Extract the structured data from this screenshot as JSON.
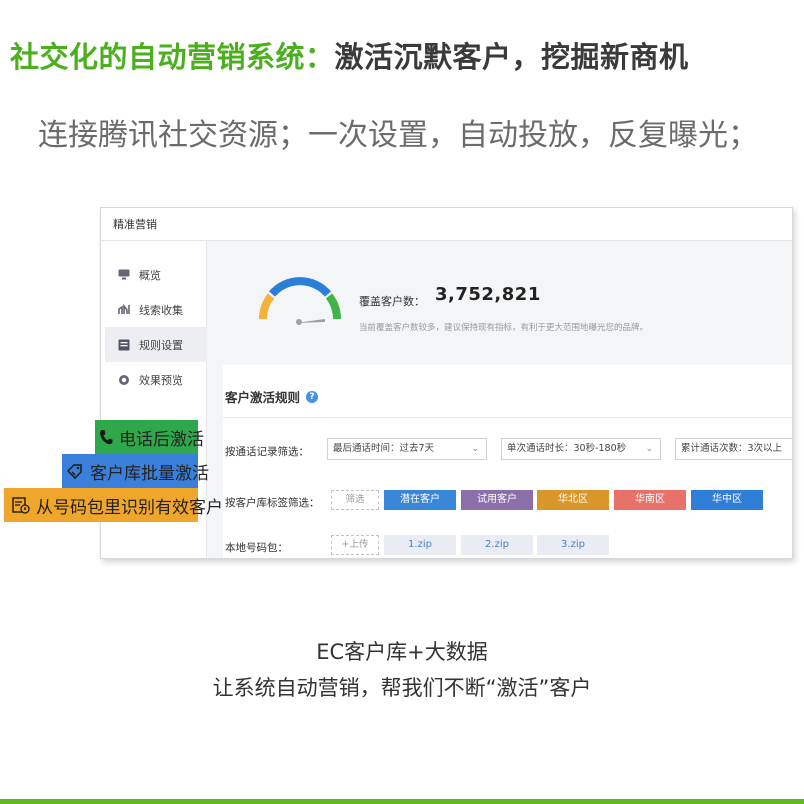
{
  "headline": {
    "green_part": "社交化的自动营销系统",
    "sep": "：",
    "dark_part": "激活沉默客户，挖掘新商机"
  },
  "subline": "连接腾讯社交资源；一次设置，自动投放，反复曝光；",
  "app": {
    "title": "精准营销",
    "sidebar": [
      {
        "label": "概览",
        "icon": "monitor-icon"
      },
      {
        "label": "线索收集",
        "icon": "funnel-icon"
      },
      {
        "label": "规则设置",
        "icon": "rules-icon"
      },
      {
        "label": "效果预览",
        "icon": "eye-icon"
      }
    ],
    "cover": {
      "label": "覆盖客户数：",
      "value": "3,752,821",
      "note": "当前覆盖客户数较多，建议保持现有指标，有利于更大范围地曝光您的品牌。"
    },
    "rules": {
      "title": "客户激活规则",
      "call_filter_label": "按通话记录筛选：",
      "call_filters": [
        "最后通话时间：过去7天",
        "单次通话时长：30秒-180秒",
        "累计通话次数：3次以上"
      ],
      "tag_filter_label": "按客户库标签筛选：",
      "tag_filter_button": "筛选",
      "tags": [
        {
          "label": "潜在客户",
          "color": "#3a86d6"
        },
        {
          "label": "试用客户",
          "color": "#8c6fa8"
        },
        {
          "label": "华北区",
          "color": "#d9962a"
        },
        {
          "label": "华南区",
          "color": "#e8726a"
        },
        {
          "label": "华中区",
          "color": "#2f7fd8"
        }
      ],
      "local_pack_label": "本地号码包：",
      "upload_button": "+上传",
      "zips": [
        "1.zip",
        "2.zip",
        "3.zip"
      ]
    }
  },
  "callouts": [
    {
      "label": "电话后激活",
      "icon": "phone-icon",
      "color": "#2ea84a"
    },
    {
      "label": "客户库批量激活",
      "icon": "tag-icon",
      "color": "#3a7fd9"
    },
    {
      "label": "从号码包里识别有效客户",
      "icon": "file-icon",
      "color": "#f0a62a"
    }
  ],
  "taglines": [
    "EC客户库+大数据",
    "让系统自动营销，帮我们不断“激活”客户"
  ]
}
